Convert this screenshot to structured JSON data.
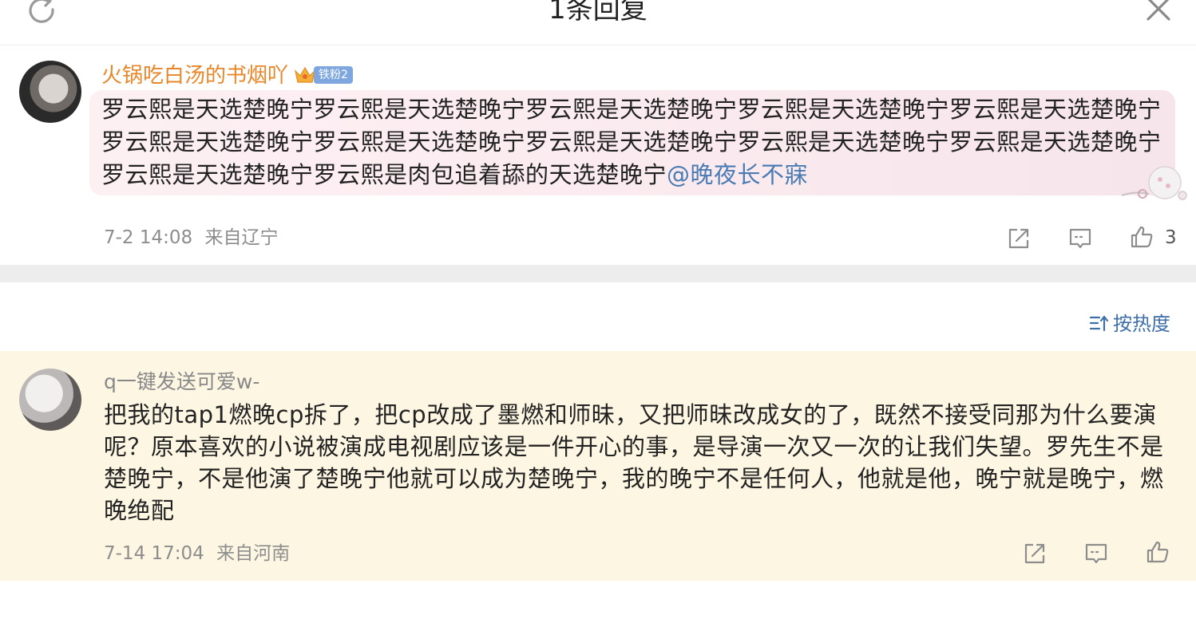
{
  "header": {
    "title": "1条回复"
  },
  "main_comment": {
    "username": "火锅吃白汤的书烟吖",
    "badge": "铁粉2",
    "content": "罗云熙是天选楚晚宁罗云熙是天选楚晚宁罗云熙是天选楚晚宁罗云熙是天选楚晚宁罗云熙是天选楚晚宁罗云熙是天选楚晚宁罗云熙是天选楚晚宁罗云熙是天选楚晚宁罗云熙是天选楚晚宁罗云熙是天选楚晚宁罗云熙是天选楚晚宁罗云熙是肉包追着舔的天选楚晚宁",
    "mention": "@晚夜长不寐",
    "time": "7-2 14:08",
    "location": "来自辽宁",
    "like_count": "3"
  },
  "sort": {
    "label": "按热度"
  },
  "reply": {
    "username": "q一键发送可爱w-",
    "content": "把我的tap1燃晚cp拆了，把cp改成了墨燃和师昧，又把师昧改成女的了，既然不接受同那为什么要演呢？原本喜欢的小说被演成电视剧应该是一件开心的事，是导演一次又一次的让我们失望。罗先生不是楚晚宁，不是他演了楚晚宁他就可以成为楚晚宁，我的晚宁不是任何人，他就是他，晚宁就是晚宁，燃晚绝配",
    "time": "7-14 17:04",
    "location": "来自河南"
  },
  "icons": {
    "refresh": "refresh-icon",
    "close": "close-icon",
    "share": "share-icon",
    "comment": "comment-icon",
    "like": "like-icon",
    "sort": "sort-icon"
  },
  "colors": {
    "username_orange": "#e8872a",
    "mention_blue": "#4a7bb3",
    "sort_blue": "#3f6fa8",
    "reply_bg": "#fdf6e3",
    "separator": "#ededed"
  }
}
